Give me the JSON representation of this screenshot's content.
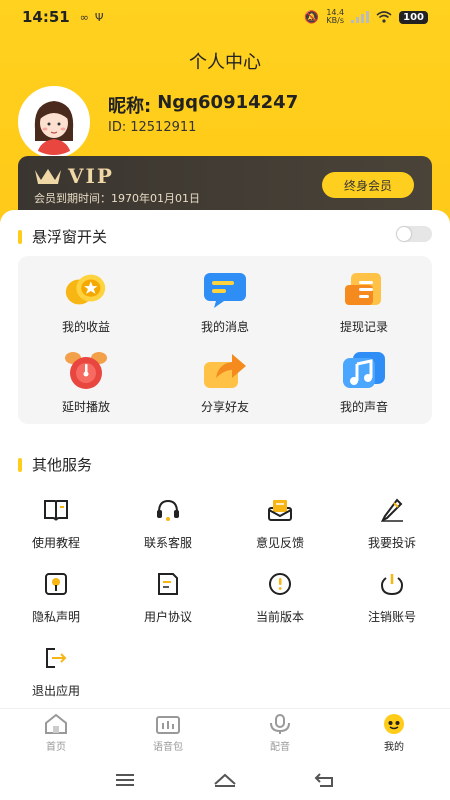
{
  "status_bar": {
    "time": "14:51",
    "net_speed_value": "14.4",
    "net_speed_unit": "KB/s",
    "battery": "100"
  },
  "header": {
    "title": "个人中心"
  },
  "profile": {
    "nickname_label": "昵称:",
    "nickname": "Ngq60914247",
    "id_label": "ID:",
    "id": "12512911"
  },
  "vip": {
    "logo_text": "VIP",
    "expire_label": "会员到期时间：",
    "expire_date": "1970年01月01日",
    "button_label": "终身会员"
  },
  "floating_window": {
    "title": "悬浮窗开关",
    "enabled": false
  },
  "features": [
    {
      "label": "我的收益",
      "icon": "coins-icon"
    },
    {
      "label": "我的消息",
      "icon": "message-icon"
    },
    {
      "label": "提现记录",
      "icon": "withdraw-record-icon"
    },
    {
      "label": "延时播放",
      "icon": "alarm-clock-icon"
    },
    {
      "label": "分享好友",
      "icon": "share-icon"
    },
    {
      "label": "我的声音",
      "icon": "music-note-icon"
    }
  ],
  "other_services": {
    "title": "其他服务",
    "items": [
      {
        "label": "使用教程",
        "icon": "book-icon"
      },
      {
        "label": "联系客服",
        "icon": "headset-icon"
      },
      {
        "label": "意见反馈",
        "icon": "feedback-icon"
      },
      {
        "label": "我要投诉",
        "icon": "pencil-icon"
      },
      {
        "label": "隐私声明",
        "icon": "privacy-icon"
      },
      {
        "label": "用户协议",
        "icon": "agreement-icon"
      },
      {
        "label": "当前版本",
        "icon": "info-icon"
      },
      {
        "label": "注销账号",
        "icon": "power-icon"
      },
      {
        "label": "退出应用",
        "icon": "logout-icon"
      }
    ]
  },
  "bottom_nav": [
    {
      "label": "首页",
      "icon": "home-icon",
      "active": false
    },
    {
      "label": "语音包",
      "icon": "voice-pack-icon",
      "active": false
    },
    {
      "label": "配音",
      "icon": "dubbing-icon",
      "active": false
    },
    {
      "label": "我的",
      "icon": "mine-icon",
      "active": true
    }
  ],
  "colors": {
    "accent": "#ffcc1a",
    "vip_bg": "#3a3530",
    "vip_gold": "#f0d7a6",
    "toggle_off": "#e6e6e6"
  }
}
